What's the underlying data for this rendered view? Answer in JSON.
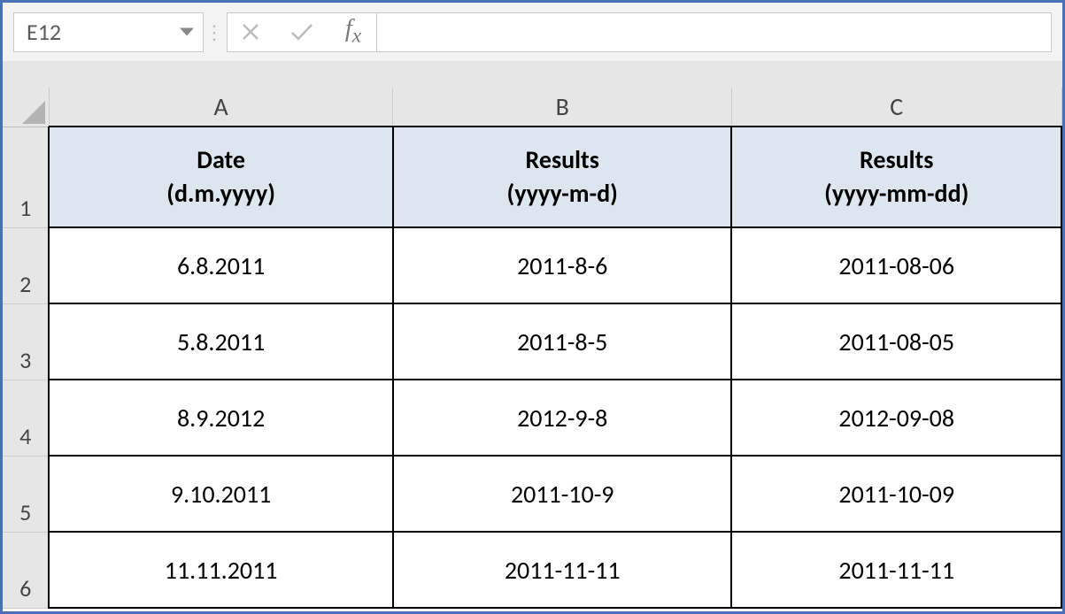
{
  "nameBox": "E12",
  "formulaValue": "",
  "columns": [
    "A",
    "B",
    "C"
  ],
  "rowNumbers": [
    "1",
    "2",
    "3",
    "4",
    "5",
    "6"
  ],
  "headers": {
    "A": {
      "line1": "Date",
      "line2": "(d.m.yyyy)"
    },
    "B": {
      "line1": "Results",
      "line2": "(yyyy-m-d)"
    },
    "C": {
      "line1": "Results",
      "line2": "(yyyy-mm-dd)"
    }
  },
  "rows": [
    {
      "A": "6.8.2011",
      "B": "2011-8-6",
      "C": "2011-08-06"
    },
    {
      "A": "5.8.2011",
      "B": "2011-8-5",
      "C": "2011-08-05"
    },
    {
      "A": "8.9.2012",
      "B": "2012-9-8",
      "C": "2012-09-08"
    },
    {
      "A": "9.10.2011",
      "B": "2011-10-9",
      "C": "2011-10-09"
    },
    {
      "A": "11.11.2011",
      "B": "2011-11-11",
      "C": "2011-11-11"
    }
  ]
}
